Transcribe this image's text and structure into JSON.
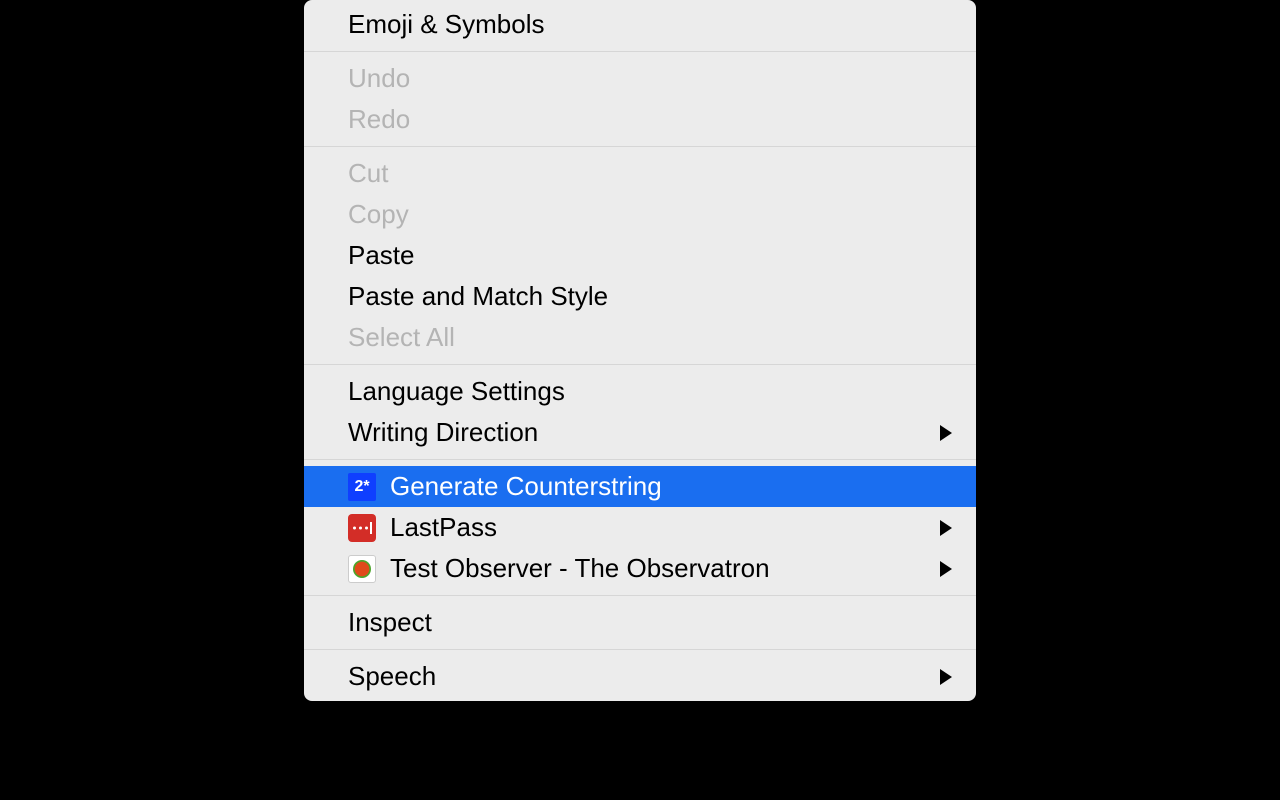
{
  "menu": {
    "groups": [
      [
        {
          "id": "emoji-symbols",
          "label": "Emoji & Symbols",
          "enabled": true,
          "submenu": false,
          "icon": null
        }
      ],
      [
        {
          "id": "undo",
          "label": "Undo",
          "enabled": false,
          "submenu": false,
          "icon": null
        },
        {
          "id": "redo",
          "label": "Redo",
          "enabled": false,
          "submenu": false,
          "icon": null
        }
      ],
      [
        {
          "id": "cut",
          "label": "Cut",
          "enabled": false,
          "submenu": false,
          "icon": null
        },
        {
          "id": "copy",
          "label": "Copy",
          "enabled": false,
          "submenu": false,
          "icon": null
        },
        {
          "id": "paste",
          "label": "Paste",
          "enabled": true,
          "submenu": false,
          "icon": null
        },
        {
          "id": "paste-match-style",
          "label": "Paste and Match Style",
          "enabled": true,
          "submenu": false,
          "icon": null
        },
        {
          "id": "select-all",
          "label": "Select All",
          "enabled": false,
          "submenu": false,
          "icon": null
        }
      ],
      [
        {
          "id": "language-settings",
          "label": "Language Settings",
          "enabled": true,
          "submenu": false,
          "icon": null
        },
        {
          "id": "writing-direction",
          "label": "Writing Direction",
          "enabled": true,
          "submenu": true,
          "icon": null
        }
      ],
      [
        {
          "id": "generate-counterstring",
          "label": "Generate Counterstring",
          "enabled": true,
          "submenu": false,
          "icon": "counterstring",
          "icon_text": "2*",
          "selected": true
        },
        {
          "id": "lastpass",
          "label": "LastPass",
          "enabled": true,
          "submenu": true,
          "icon": "lastpass"
        },
        {
          "id": "test-observer",
          "label": "Test Observer - The Observatron",
          "enabled": true,
          "submenu": true,
          "icon": "observatron"
        }
      ],
      [
        {
          "id": "inspect",
          "label": "Inspect",
          "enabled": true,
          "submenu": false,
          "icon": null
        }
      ],
      [
        {
          "id": "speech",
          "label": "Speech",
          "enabled": true,
          "submenu": true,
          "icon": null
        }
      ]
    ]
  }
}
